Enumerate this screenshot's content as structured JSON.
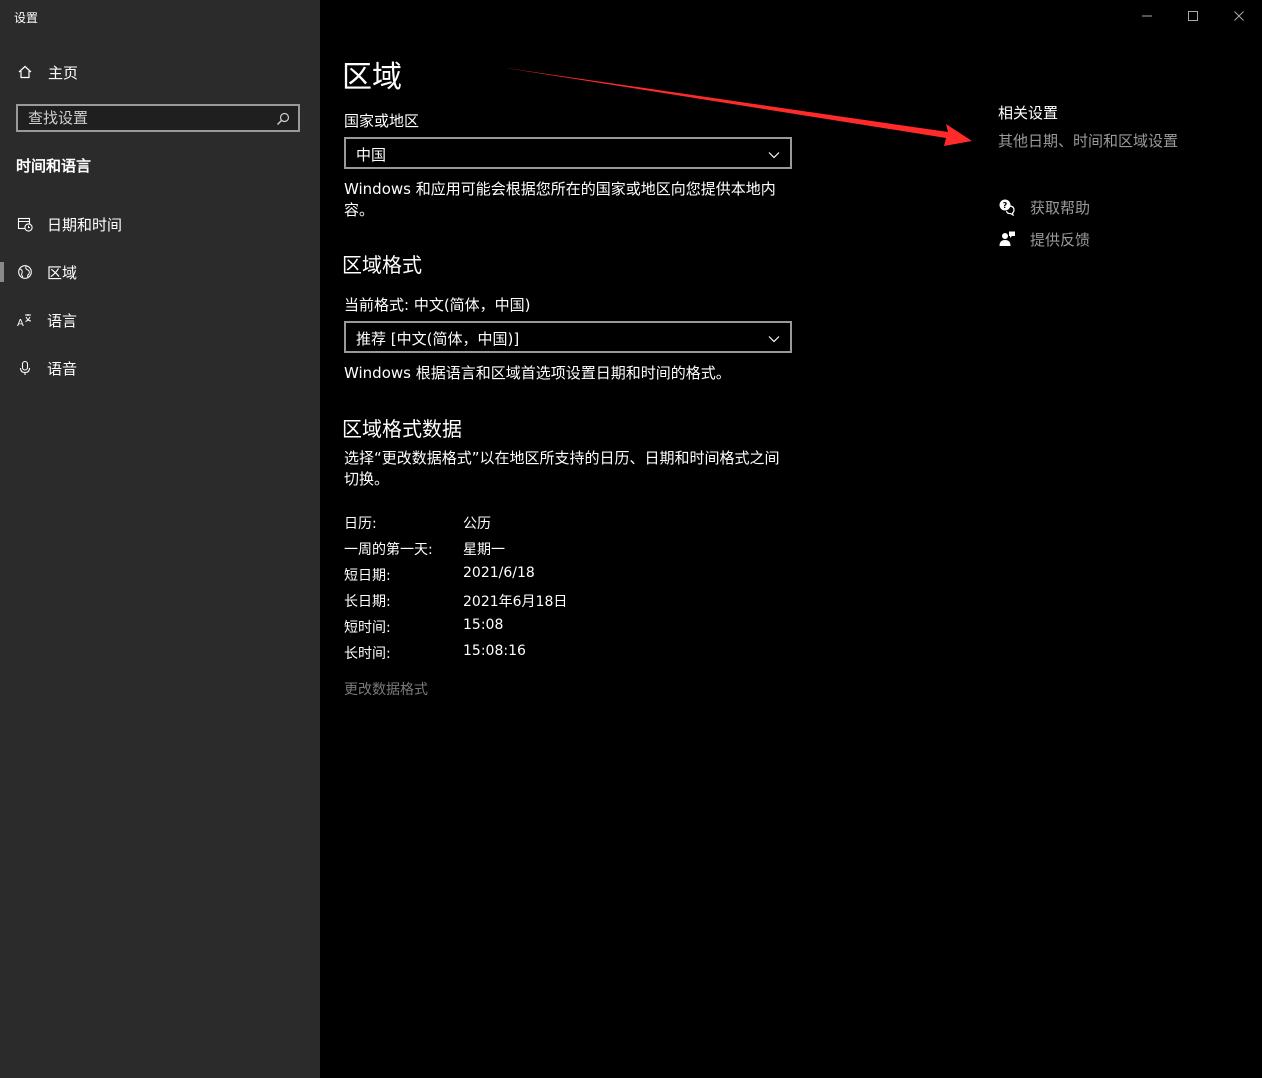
{
  "window": {
    "title": "设置",
    "minimize_icon": "minimize-icon",
    "maximize_icon": "maximize-icon",
    "close_icon": "close-icon"
  },
  "sidebar": {
    "home": {
      "label": "主页",
      "icon": "home-icon"
    },
    "search": {
      "placeholder": "查找设置",
      "value": "",
      "icon": "search-icon"
    },
    "section_title": "时间和语言",
    "items": [
      {
        "label": "日期和时间",
        "icon": "calendar-clock-icon"
      },
      {
        "label": "区域",
        "icon": "globe-icon",
        "selected": true
      },
      {
        "label": "语言",
        "icon": "language-icon"
      },
      {
        "label": "语音",
        "icon": "microphone-icon"
      }
    ]
  },
  "main": {
    "page_title": "区域",
    "country_label": "国家或地区",
    "country_value": "中国",
    "country_desc": "Windows 和应用可能会根据您所在的国家或地区向您提供本地内容。",
    "format_heading": "区域格式",
    "current_format_label": "当前格式: 中文(简体，中国)",
    "format_value": "推荐 [中文(简体，中国)]",
    "format_desc": "Windows 根据语言和区域首选项设置日期和时间的格式。",
    "format_data_heading": "区域格式数据",
    "format_data_desc": "选择“更改数据格式”以在地区所支持的日历、日期和时间格式之间切换。",
    "format_data": [
      {
        "label": "日历:",
        "value": "公历"
      },
      {
        "label": "一周的第一天:",
        "value": "星期一"
      },
      {
        "label": "短日期:",
        "value": "2021/6/18"
      },
      {
        "label": "长日期:",
        "value": "2021年6月18日"
      },
      {
        "label": "短时间:",
        "value": "15:08"
      },
      {
        "label": "长时间:",
        "value": "15:08:16"
      }
    ],
    "change_format_link": "更改数据格式"
  },
  "related": {
    "title": "相关设置",
    "link": "其他日期、时间和区域设置",
    "help": {
      "label": "获取帮助",
      "icon": "help-chat-icon"
    },
    "feedback": {
      "label": "提供反馈",
      "icon": "feedback-icon"
    }
  },
  "colors": {
    "sidebar_bg": "#2b2b2b",
    "main_bg": "#000000",
    "annotation_arrow": "#ff2a2a"
  }
}
